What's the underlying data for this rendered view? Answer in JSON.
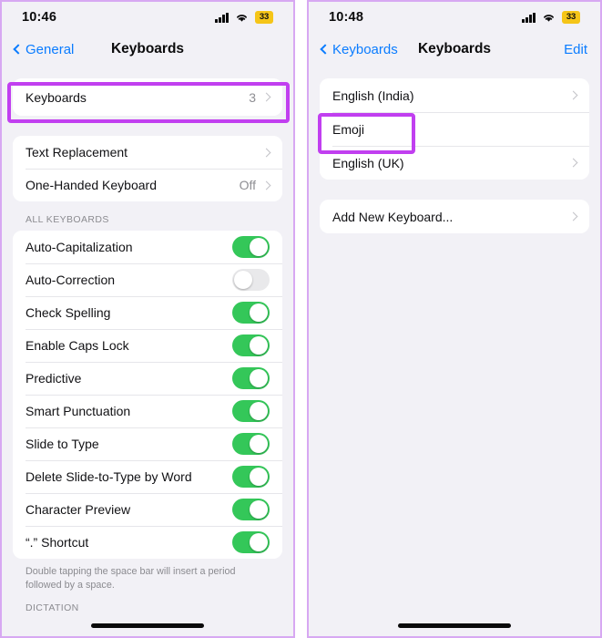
{
  "left_panel": {
    "status": {
      "time": "10:46",
      "battery_level": "33",
      "signal_icon": "cellular-signal-icon",
      "wifi_icon": "wifi-icon",
      "battery_icon": "battery-low-power-icon"
    },
    "nav": {
      "back_label": "General",
      "title": "Keyboards",
      "back_icon": "chevron-left-icon"
    },
    "keyboards_row": {
      "label": "Keyboards",
      "value": "3",
      "chevron_icon": "chevron-right-icon"
    },
    "group2": [
      {
        "label": "Text Replacement",
        "value": "",
        "chevron_icon": "chevron-right-icon"
      },
      {
        "label": "One-Handed Keyboard",
        "value": "Off",
        "chevron_icon": "chevron-right-icon"
      }
    ],
    "all_keyboards_header": "ALL KEYBOARDS",
    "toggles": [
      {
        "label": "Auto-Capitalization",
        "state": "on"
      },
      {
        "label": "Auto-Correction",
        "state": "off"
      },
      {
        "label": "Check Spelling",
        "state": "on"
      },
      {
        "label": "Enable Caps Lock",
        "state": "on"
      },
      {
        "label": "Predictive",
        "state": "on"
      },
      {
        "label": "Smart Punctuation",
        "state": "on"
      },
      {
        "label": "Slide to Type",
        "state": "on"
      },
      {
        "label": "Delete Slide-to-Type by Word",
        "state": "on"
      },
      {
        "label": "Character Preview",
        "state": "on"
      },
      {
        "label": "“.” Shortcut",
        "state": "on"
      }
    ],
    "footer_text": "Double tapping the space bar will insert a period followed by a space.",
    "dictation_header": "DICTATION"
  },
  "right_panel": {
    "status": {
      "time": "10:48",
      "battery_level": "33",
      "signal_icon": "cellular-signal-icon",
      "wifi_icon": "wifi-icon",
      "battery_icon": "battery-low-power-icon"
    },
    "nav": {
      "back_label": "Keyboards",
      "title": "Keyboards",
      "edit_label": "Edit",
      "back_icon": "chevron-left-icon"
    },
    "keyboard_list": [
      {
        "label": "English (India)",
        "has_chevron": true
      },
      {
        "label": "Emoji",
        "has_chevron": false
      },
      {
        "label": "English (UK)",
        "has_chevron": true
      }
    ],
    "add_row": {
      "label": "Add New Keyboard...",
      "has_chevron": true
    }
  },
  "colors": {
    "accent_blue": "#0a7cff",
    "toggle_on_green": "#34c759",
    "highlight_purple": "#c13ff0",
    "battery_yellow": "#f5c518",
    "page_background": "#f2f1f6"
  }
}
